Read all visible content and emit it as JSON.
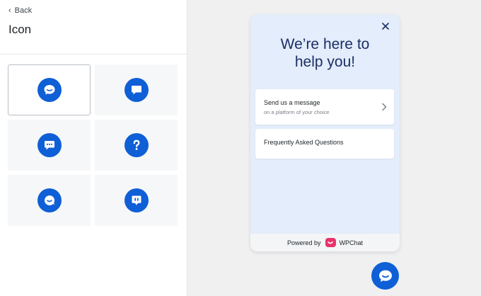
{
  "sidebar": {
    "back_label": "Back",
    "title": "Icon",
    "icons": [
      {
        "icon": "smile-chat-bubble-icon",
        "selected": true
      },
      {
        "icon": "square-chat-bubble-icon",
        "selected": false
      },
      {
        "icon": "dots-chat-bubble-icon",
        "selected": false
      },
      {
        "icon": "question-mark-icon",
        "selected": false
      },
      {
        "icon": "smile-round-bubble-icon",
        "selected": false
      },
      {
        "icon": "exclamation-bubble-icon",
        "selected": false
      }
    ]
  },
  "preview": {
    "headline": "We’re here to help you!",
    "options": [
      {
        "title": "Send us a message",
        "subtitle": "on a platform of your choice"
      },
      {
        "title": "Frequently Asked Questions"
      }
    ],
    "footer": {
      "powered_by": "Powered by",
      "brand": "WPChat"
    }
  },
  "colors": {
    "accent": "#0f5fd6",
    "headline": "#1c2e66",
    "brand": "#e8336a",
    "card_bg": "#e3edfb"
  }
}
